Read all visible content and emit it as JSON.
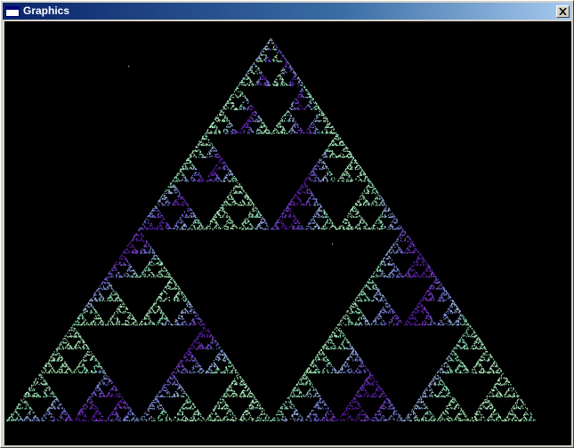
{
  "window": {
    "title": "Graphics",
    "close_icon": "close-icon"
  },
  "canvas": {
    "background": "#000000",
    "content": "sierpinski-triangle-fractal",
    "colors": [
      "#5a1fa8",
      "#7a3cd0",
      "#6f5fd0",
      "#7f8fe0",
      "#9fb8e8",
      "#8ee0b8",
      "#aef0c0"
    ]
  }
}
